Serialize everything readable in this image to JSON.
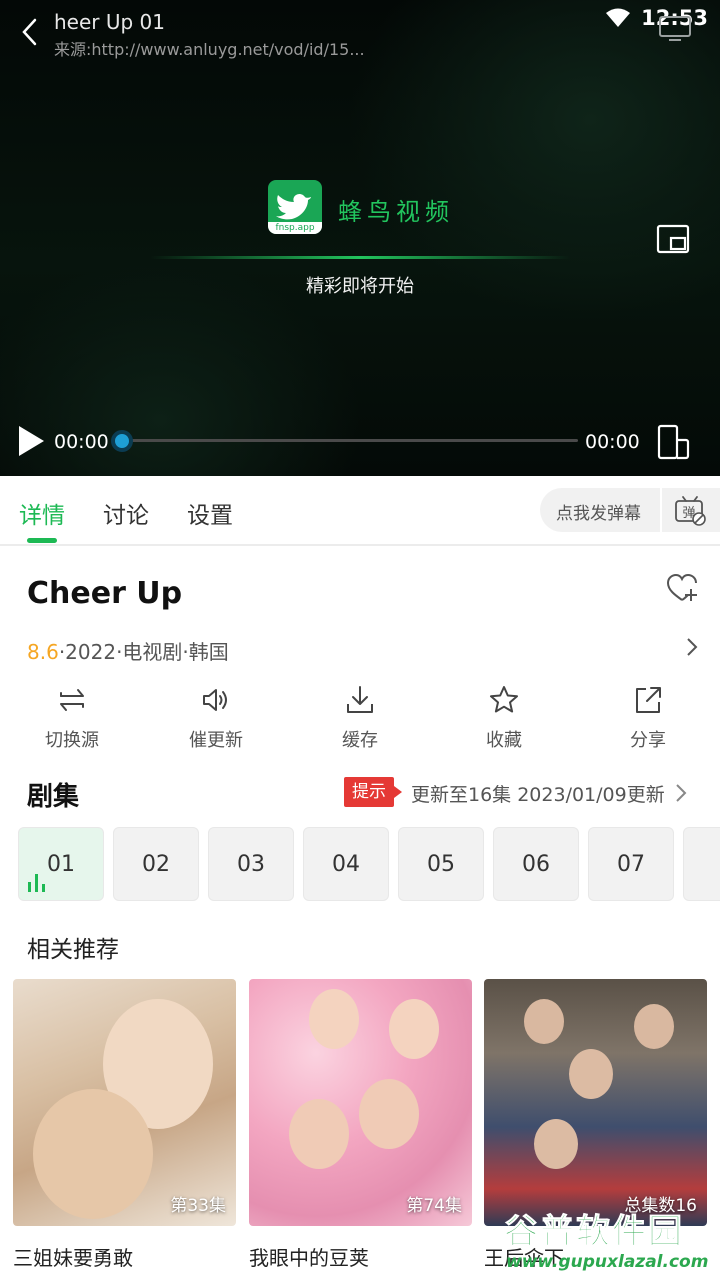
{
  "status_bar": {
    "time": "12:53"
  },
  "player": {
    "title": "heer Up 01",
    "source": "来源:http://www.anluyg.net/vod/id/15...",
    "splash_logo_sub": "fnsp.app",
    "splash_name": "蜂鸟视频",
    "splash_message": "精彩即将开始",
    "current_time": "00:00",
    "total_time": "00:00",
    "progress": 0
  },
  "tabs": {
    "items": [
      {
        "label": "详情",
        "active": true
      },
      {
        "label": "讨论",
        "active": false
      },
      {
        "label": "设置",
        "active": false
      }
    ],
    "danmu_placeholder": "点我发弹幕"
  },
  "details": {
    "title": "Cheer Up",
    "score": "8.6",
    "meta_rest": "·2022·电视剧·韩国"
  },
  "actions": [
    {
      "label": "切换源",
      "icon": "switch-source-icon"
    },
    {
      "label": "催更新",
      "icon": "speaker-icon"
    },
    {
      "label": "缓存",
      "icon": "download-icon"
    },
    {
      "label": "收藏",
      "icon": "star-icon"
    },
    {
      "label": "分享",
      "icon": "share-icon"
    }
  ],
  "episodes": {
    "heading": "剧集",
    "tip_badge": "提示",
    "update_text": "更新至16集  2023/01/09更新",
    "items": [
      "01",
      "02",
      "03",
      "04",
      "05",
      "06",
      "07"
    ],
    "active_index": 0
  },
  "recommendations": {
    "heading": "相关推荐",
    "items": [
      {
        "name": "三姐妹要勇敢",
        "caption": "第33集"
      },
      {
        "name": "我眼中的豆荚",
        "caption": "第74集"
      },
      {
        "name": "王后伞下",
        "caption": "总集数16"
      }
    ]
  },
  "watermark": {
    "main": "谷普软件园",
    "url": "www.gupuxlazal.com"
  },
  "colors": {
    "accent": "#1db954",
    "score": "#f5a623",
    "tip": "#e53935",
    "progress_thumb": "#1e9fd6"
  }
}
